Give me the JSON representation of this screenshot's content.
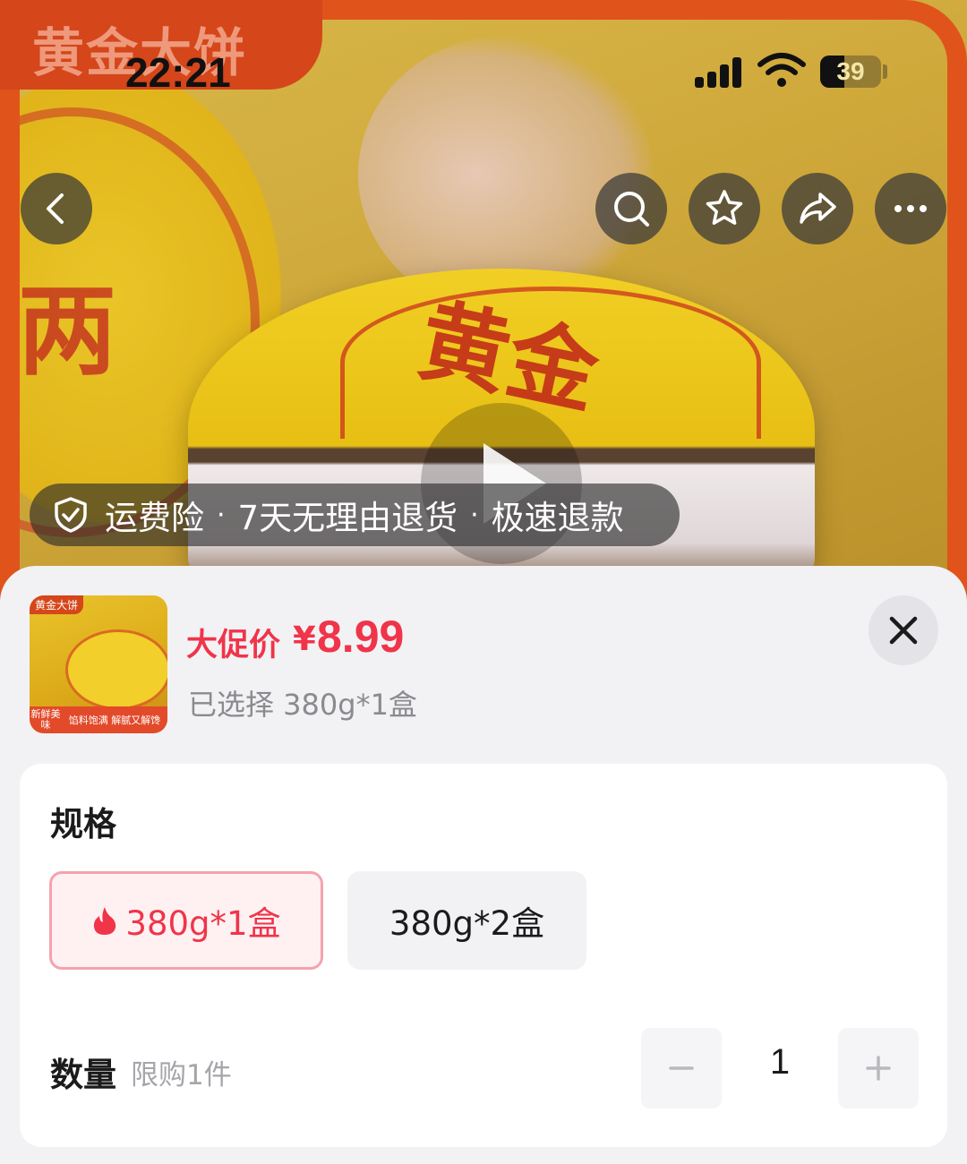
{
  "status_bar": {
    "time": "22:21",
    "battery_level": "39"
  },
  "hero": {
    "brand_text": "黄金大饼",
    "stamp_text": "黄金",
    "left_glyph": "两"
  },
  "nav": {
    "back": "back-icon",
    "search": "search-icon",
    "favorite": "star-icon",
    "share": "share-icon",
    "more": "more-icon"
  },
  "services": {
    "items": [
      "运费险",
      "7天无理由退货",
      "极速退款"
    ],
    "separator": "·"
  },
  "product": {
    "thumb_brand": "黄金大饼",
    "thumb_tag_left": "新鲜美味",
    "thumb_tag_right": "馅料饱满 解腻又解馋",
    "price_label": "大促价",
    "currency": "¥",
    "price": "8.99",
    "selected_text": "已选择 380g*1盒"
  },
  "spec": {
    "title": "规格",
    "options": [
      {
        "label": "380g*1盒",
        "selected": true,
        "hot": true
      },
      {
        "label": "380g*2盒",
        "selected": false,
        "hot": false
      }
    ]
  },
  "quantity": {
    "title": "数量",
    "limit": "限购1件",
    "value": "1"
  },
  "colors": {
    "accent": "#f0344a",
    "frame": "#e0541b"
  }
}
